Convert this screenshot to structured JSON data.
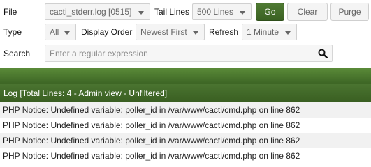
{
  "filters": {
    "file_label": "File",
    "file_value": "cacti_stderr.log [0515]",
    "tail_label": "Tail Lines",
    "tail_value": "500 Lines",
    "go_label": "Go",
    "clear_label": "Clear",
    "purge_label": "Purge",
    "type_label": "Type",
    "type_value": "All",
    "order_label": "Display Order",
    "order_value": "Newest First",
    "refresh_label": "Refresh",
    "refresh_value": "1 Minute",
    "search_label": "Search",
    "search_placeholder": "Enter a regular expression",
    "search_value": ""
  },
  "log": {
    "header": "Log [Total Lines: 4 - Admin view - Unfiltered]",
    "lines": [
      "PHP Notice: Undefined variable: poller_id in /var/www/cacti/cmd.php on line 862",
      "PHP Notice: Undefined variable: poller_id in /var/www/cacti/cmd.php on line 862",
      "PHP Notice: Undefined variable: poller_id in /var/www/cacti/cmd.php on line 862",
      "PHP Notice: Undefined variable: poller_id in /var/www/cacti/cmd.php on line 862"
    ]
  },
  "colors": {
    "accent_green": "#3d6625",
    "go_button": "#4f7a33"
  }
}
